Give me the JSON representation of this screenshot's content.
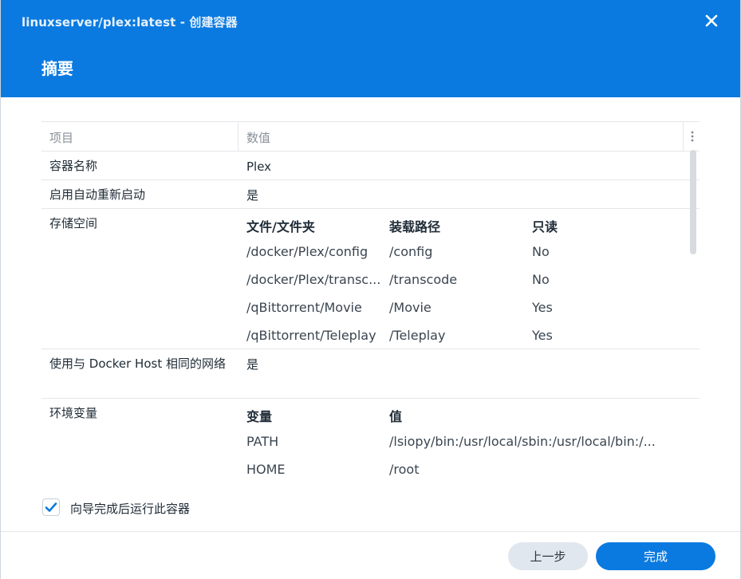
{
  "window": {
    "title": "linuxserver/plex:latest - 创建容器",
    "step_title": "摘要"
  },
  "table": {
    "col_item": "项目",
    "col_value": "数值",
    "rows": {
      "name": {
        "label": "容器名称",
        "value": "Plex"
      },
      "autorestart": {
        "label": "启用自动重新启动",
        "value": "是"
      },
      "storage": {
        "label": "存储空间",
        "headers": [
          "文件/文件夹",
          "装载路径",
          "只读"
        ],
        "entries": [
          [
            "/docker/Plex/config",
            "/config",
            "No"
          ],
          [
            "/docker/Plex/transc...",
            "/transcode",
            "No"
          ],
          [
            "/qBittorrent/Movie",
            "/Movie",
            "Yes"
          ],
          [
            "/qBittorrent/Teleplay",
            "/Teleplay",
            "Yes"
          ]
        ]
      },
      "network": {
        "label": "使用与 Docker Host 相同的网络",
        "value": "是"
      },
      "env": {
        "label": "环境变量",
        "headers": [
          "变量",
          "值"
        ],
        "entries": [
          [
            "PATH",
            "/lsiopy/bin:/usr/local/sbin:/usr/local/bin:/..."
          ],
          [
            "HOME",
            "/root"
          ]
        ]
      }
    }
  },
  "footer": {
    "run_after_label": "向导完成后运行此容器",
    "run_after_checked": true,
    "prev_label": "上一步",
    "done_label": "完成"
  },
  "colors": {
    "accent": "#0a7ae0",
    "header_bg": "#0a7ae0"
  },
  "icons": {
    "close": "close-icon",
    "menu": "vertical-ellipsis-icon",
    "check": "checkmark-icon"
  }
}
